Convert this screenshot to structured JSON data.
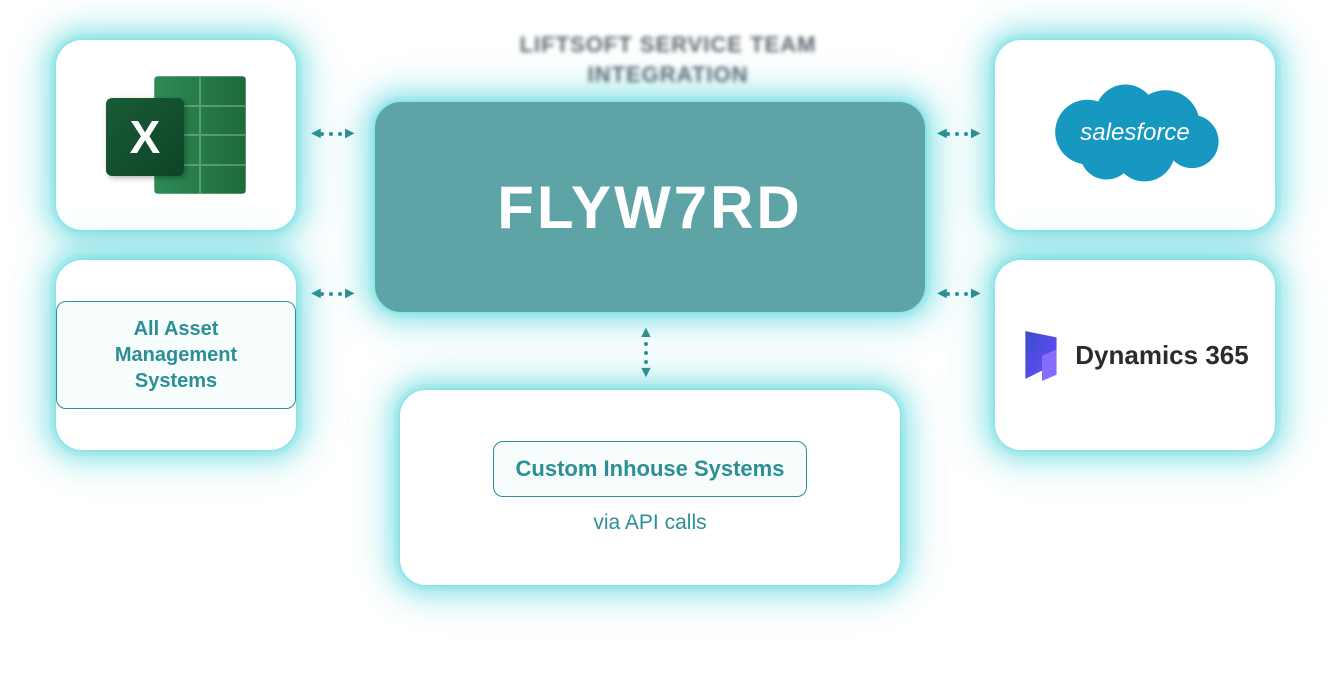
{
  "title": "LIFTSOFT SERVICE TEAM\nINTEGRATION",
  "center": {
    "logo_text": "FLYW7RD"
  },
  "left": {
    "excel": {
      "badge": "X"
    },
    "ams": {
      "chip": "All Asset Management Systems"
    }
  },
  "right": {
    "salesforce": {
      "text": "salesforce"
    },
    "dynamics": {
      "text": "Dynamics 365"
    }
  },
  "bottom": {
    "custom": {
      "chip": "Custom Inhouse Systems",
      "caption": "via API calls"
    }
  },
  "colors": {
    "teal": "#5ea3a6",
    "teal_dark": "#2c8f94",
    "sf_blue": "#1798c1"
  }
}
